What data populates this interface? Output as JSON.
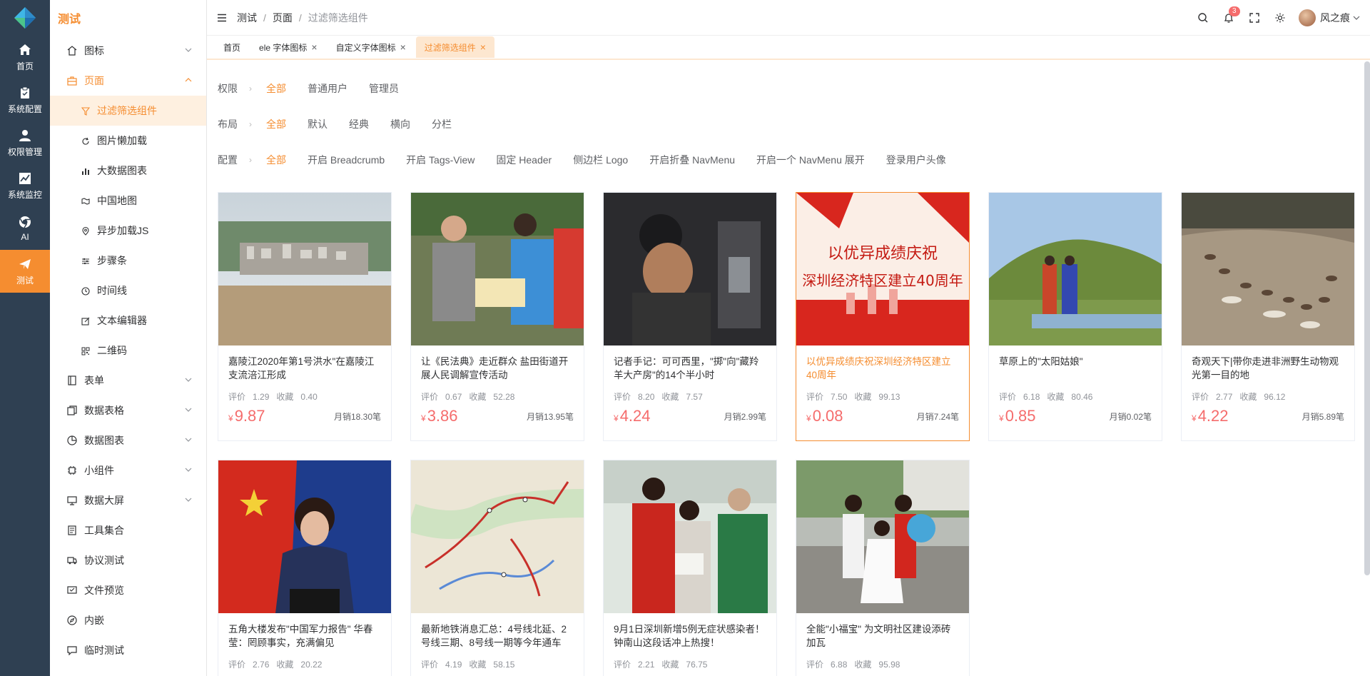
{
  "rail": [
    {
      "label": "首页",
      "icon": "home-icon"
    },
    {
      "label": "系统配置",
      "icon": "clipboard-icon"
    },
    {
      "label": "权限管理",
      "icon": "user-icon"
    },
    {
      "label": "系统监控",
      "icon": "chart-line-icon"
    },
    {
      "label": "AI",
      "icon": "chrome-icon"
    },
    {
      "label": "测试",
      "icon": "paper-plane-icon"
    }
  ],
  "menu": {
    "title": "测试",
    "items": [
      {
        "label": "图标",
        "icon": "house-icon"
      },
      {
        "label": "页面",
        "icon": "briefcase-icon"
      },
      {
        "label": "过滤筛选组件",
        "icon": "filter-icon"
      },
      {
        "label": "图片懒加载",
        "icon": "refresh-icon"
      },
      {
        "label": "大数据图表",
        "icon": "bar-chart-icon"
      },
      {
        "label": "中国地图",
        "icon": "map-icon"
      },
      {
        "label": "异步加载JS",
        "icon": "location-icon"
      },
      {
        "label": "步骤条",
        "icon": "sliders-icon"
      },
      {
        "label": "时间线",
        "icon": "clock-icon"
      },
      {
        "label": "文本编辑器",
        "icon": "edit-icon"
      },
      {
        "label": "二维码",
        "icon": "qrcode-icon"
      },
      {
        "label": "表单",
        "icon": "notebook-icon"
      },
      {
        "label": "数据表格",
        "icon": "copy-icon"
      },
      {
        "label": "数据图表",
        "icon": "pie-chart-icon"
      },
      {
        "label": "小组件",
        "icon": "cpu-icon"
      },
      {
        "label": "数据大屏",
        "icon": "monitor-icon"
      },
      {
        "label": "工具集合",
        "icon": "document-icon"
      },
      {
        "label": "协议测试",
        "icon": "truck-icon"
      },
      {
        "label": "文件预览",
        "icon": "screen-icon"
      },
      {
        "label": "内嵌",
        "icon": "compass-icon"
      },
      {
        "label": "临时测试",
        "icon": "message-icon"
      }
    ]
  },
  "header": {
    "breadcrumb": [
      "测试",
      "页面",
      "过滤筛选组件"
    ],
    "notifications": "3",
    "username": "风之痕"
  },
  "tabs": [
    {
      "label": "首页"
    },
    {
      "label": "ele 字体图标"
    },
    {
      "label": "自定义字体图标"
    },
    {
      "label": "过滤筛选组件"
    }
  ],
  "filters": [
    {
      "label": "权限",
      "options": [
        "全部",
        "普通用户",
        "管理员"
      ]
    },
    {
      "label": "布局",
      "options": [
        "全部",
        "默认",
        "经典",
        "横向",
        "分栏"
      ]
    },
    {
      "label": "配置",
      "options": [
        "全部",
        "开启 Breadcrumb",
        "开启 Tags-View",
        "固定 Header",
        "侧边栏 Logo",
        "开启折叠 NavMenu",
        "开启一个 NavMenu 展开",
        "登录用户头像"
      ]
    }
  ],
  "labels": {
    "rating": "评价",
    "collect": "收藏",
    "currency": "¥"
  },
  "cards": [
    {
      "title": "嘉陵江2020年第1号洪水\"在嘉陵江支流涪江形成",
      "rating": "1.29",
      "collect": "0.40",
      "price": "9.87",
      "sales": "月销18.30笔"
    },
    {
      "title": "让《民法典》走近群众 盐田街道开展人民调解宣传活动",
      "rating": "0.67",
      "collect": "52.28",
      "price": "3.86",
      "sales": "月销13.95笔"
    },
    {
      "title": "记者手记：可可西里，\"掷\"向\"藏羚羊大产房\"的14个半小时",
      "rating": "8.20",
      "collect": "7.57",
      "price": "4.24",
      "sales": "月销2.99笔"
    },
    {
      "title": "以优异成绩庆祝深圳经济特区建立40周年",
      "rating": "7.50",
      "collect": "99.13",
      "price": "0.08",
      "sales": "月销7.24笔"
    },
    {
      "title": "草原上的\"太阳姑娘\"",
      "rating": "6.18",
      "collect": "80.46",
      "price": "0.85",
      "sales": "月销0.02笔"
    },
    {
      "title": "奇观天下|带你走进非洲野生动物观光第一目的地",
      "rating": "2.77",
      "collect": "96.12",
      "price": "4.22",
      "sales": "月销5.89笔"
    },
    {
      "title": "五角大楼发布\"中国军力报告\" 华春莹：罔顾事实，充满偏见",
      "rating": "2.76",
      "collect": "20.22",
      "price": "",
      "sales": ""
    },
    {
      "title": "最新地铁消息汇总：4号线北延、2号线三期、8号线一期等今年通车",
      "rating": "4.19",
      "collect": "58.15",
      "price": "",
      "sales": ""
    },
    {
      "title": "9月1日深圳新增5例无症状感染者！钟南山这段话冲上热搜！",
      "rating": "2.21",
      "collect": "76.75",
      "price": "",
      "sales": ""
    },
    {
      "title": "全能\"小福宝\" 为文明社区建设添砖加瓦",
      "rating": "6.88",
      "collect": "95.98",
      "price": "",
      "sales": ""
    }
  ],
  "banner_text": [
    "以优异成绩庆祝",
    "深圳经济特区建立40周年"
  ],
  "colors": {
    "accent": "#f58d30",
    "rail_bg": "#2f4052",
    "price": "#f56c6c"
  }
}
